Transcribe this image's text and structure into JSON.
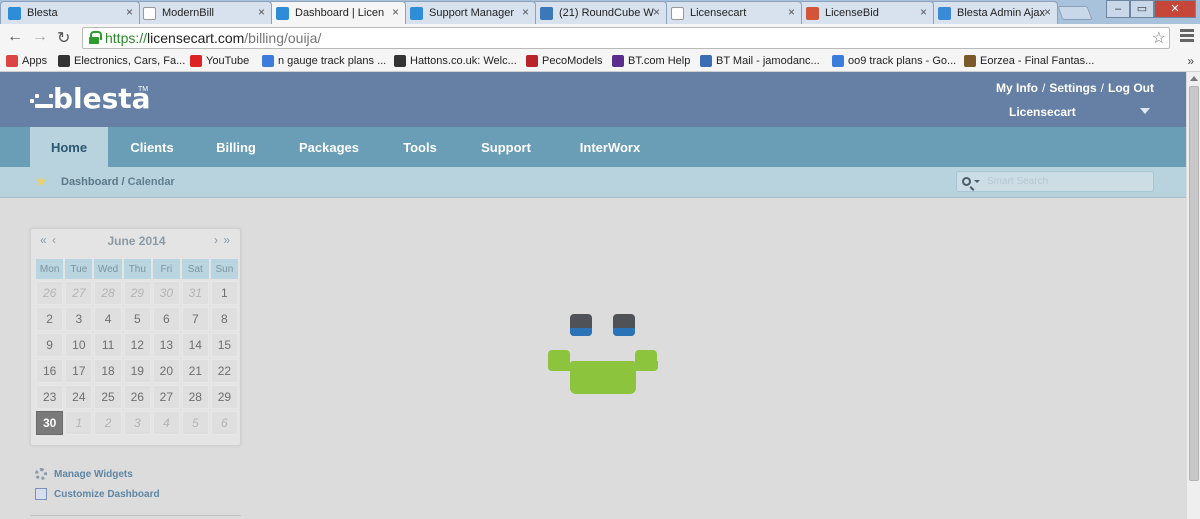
{
  "browser": {
    "tabs": [
      {
        "title": "Blesta",
        "icon": "blesta-icon",
        "color": "#2f8dd8"
      },
      {
        "title": "ModernBill",
        "icon": "page-icon",
        "color": "#ffffff"
      },
      {
        "title": "Dashboard | Licen",
        "icon": "blesta-icon",
        "color": "#2f8dd8"
      },
      {
        "title": "Support Manager",
        "icon": "blesta-icon",
        "color": "#2f8dd8"
      },
      {
        "title": "(21) RoundCube W",
        "icon": "roundcube-icon",
        "color": "#3a78b8"
      },
      {
        "title": "Licensecart",
        "icon": "page-icon",
        "color": "#ffffff"
      },
      {
        "title": "LicenseBid",
        "icon": "licensebid-icon",
        "color": "#d2553a"
      },
      {
        "title": "Blesta Admin Ajax",
        "icon": "blesta-v-icon",
        "color": "#3a8ad8"
      }
    ],
    "tab_close_glyph": "×",
    "window_buttons": {
      "minimize": "–",
      "maximize": "▭",
      "close": "✕"
    },
    "url": {
      "scheme": "https://",
      "host": "licensecart.com",
      "path": "/billing/ouija/"
    },
    "bookmarks": [
      {
        "label": "Apps",
        "icon": "apps-icon",
        "color": "#d44"
      },
      {
        "label": "Electronics, Cars, Fa...",
        "icon": "ebay-icon",
        "color": "#333"
      },
      {
        "label": "YouTube",
        "icon": "youtube-icon",
        "color": "#d22"
      },
      {
        "label": "n gauge track plans ...",
        "icon": "google-icon",
        "color": "#3c7ddb"
      },
      {
        "label": "Hattons.co.uk: Welc...",
        "icon": "hattons-icon",
        "color": "#333"
      },
      {
        "label": "PecoModels",
        "icon": "peco-icon",
        "color": "#b8242a"
      },
      {
        "label": "BT.com Help",
        "icon": "bt-icon",
        "color": "#5b2d8c"
      },
      {
        "label": "BT Mail - jamodanc...",
        "icon": "btmail-icon",
        "color": "#3b6db4"
      },
      {
        "label": "oo9 track plans - Go...",
        "icon": "google-icon",
        "color": "#3c7ddb"
      },
      {
        "label": "Eorzea - Final Fantas...",
        "icon": "ffxiv-icon",
        "color": "#7a5a2a"
      }
    ],
    "bookmarks_more": "»"
  },
  "header": {
    "logo_text": "blesta",
    "logo_tm": "TM",
    "links": [
      "My Info",
      "Settings",
      "Log Out"
    ],
    "link_separator": "/",
    "company": "Licensecart"
  },
  "nav": {
    "items": [
      "Home",
      "Clients",
      "Billing",
      "Packages",
      "Tools",
      "Support",
      "InterWorx"
    ],
    "active": "Home"
  },
  "breadcrumb": {
    "root": "Dashboard",
    "separator": " / ",
    "current": "Calendar"
  },
  "search": {
    "placeholder": "Smart Search"
  },
  "calendar": {
    "month_label": "June 2014",
    "prev_glyphs": "« ‹",
    "next_glyphs": "› »",
    "weekdays": [
      "Mon",
      "Tue",
      "Wed",
      "Thu",
      "Fri",
      "Sat",
      "Sun"
    ],
    "weeks": [
      [
        {
          "d": "26",
          "o": true
        },
        {
          "d": "27",
          "o": true
        },
        {
          "d": "28",
          "o": true
        },
        {
          "d": "29",
          "o": true
        },
        {
          "d": "30",
          "o": true
        },
        {
          "d": "31",
          "o": true
        },
        {
          "d": "1"
        }
      ],
      [
        {
          "d": "2"
        },
        {
          "d": "3"
        },
        {
          "d": "4"
        },
        {
          "d": "5"
        },
        {
          "d": "6"
        },
        {
          "d": "7"
        },
        {
          "d": "8"
        }
      ],
      [
        {
          "d": "9"
        },
        {
          "d": "10"
        },
        {
          "d": "11"
        },
        {
          "d": "12"
        },
        {
          "d": "13"
        },
        {
          "d": "14"
        },
        {
          "d": "15"
        }
      ],
      [
        {
          "d": "16"
        },
        {
          "d": "17"
        },
        {
          "d": "18"
        },
        {
          "d": "19"
        },
        {
          "d": "20"
        },
        {
          "d": "21"
        },
        {
          "d": "22"
        }
      ],
      [
        {
          "d": "23"
        },
        {
          "d": "24"
        },
        {
          "d": "25"
        },
        {
          "d": "26"
        },
        {
          "d": "27"
        },
        {
          "d": "28"
        },
        {
          "d": "29"
        }
      ],
      [
        {
          "d": "30",
          "today": true
        },
        {
          "d": "1",
          "o": true
        },
        {
          "d": "2",
          "o": true
        },
        {
          "d": "3",
          "o": true
        },
        {
          "d": "4",
          "o": true
        },
        {
          "d": "5",
          "o": true
        },
        {
          "d": "6",
          "o": true
        }
      ]
    ]
  },
  "sidebar": {
    "manage_widgets": "Manage Widgets",
    "customize_dashboard": "Customize Dashboard"
  },
  "colors": {
    "header": "#6580a4",
    "nav": "#6a9db6",
    "crumb_bar": "#b8d3dd",
    "loader_green": "#8cc43e",
    "loader_blue": "#2a73b7"
  }
}
